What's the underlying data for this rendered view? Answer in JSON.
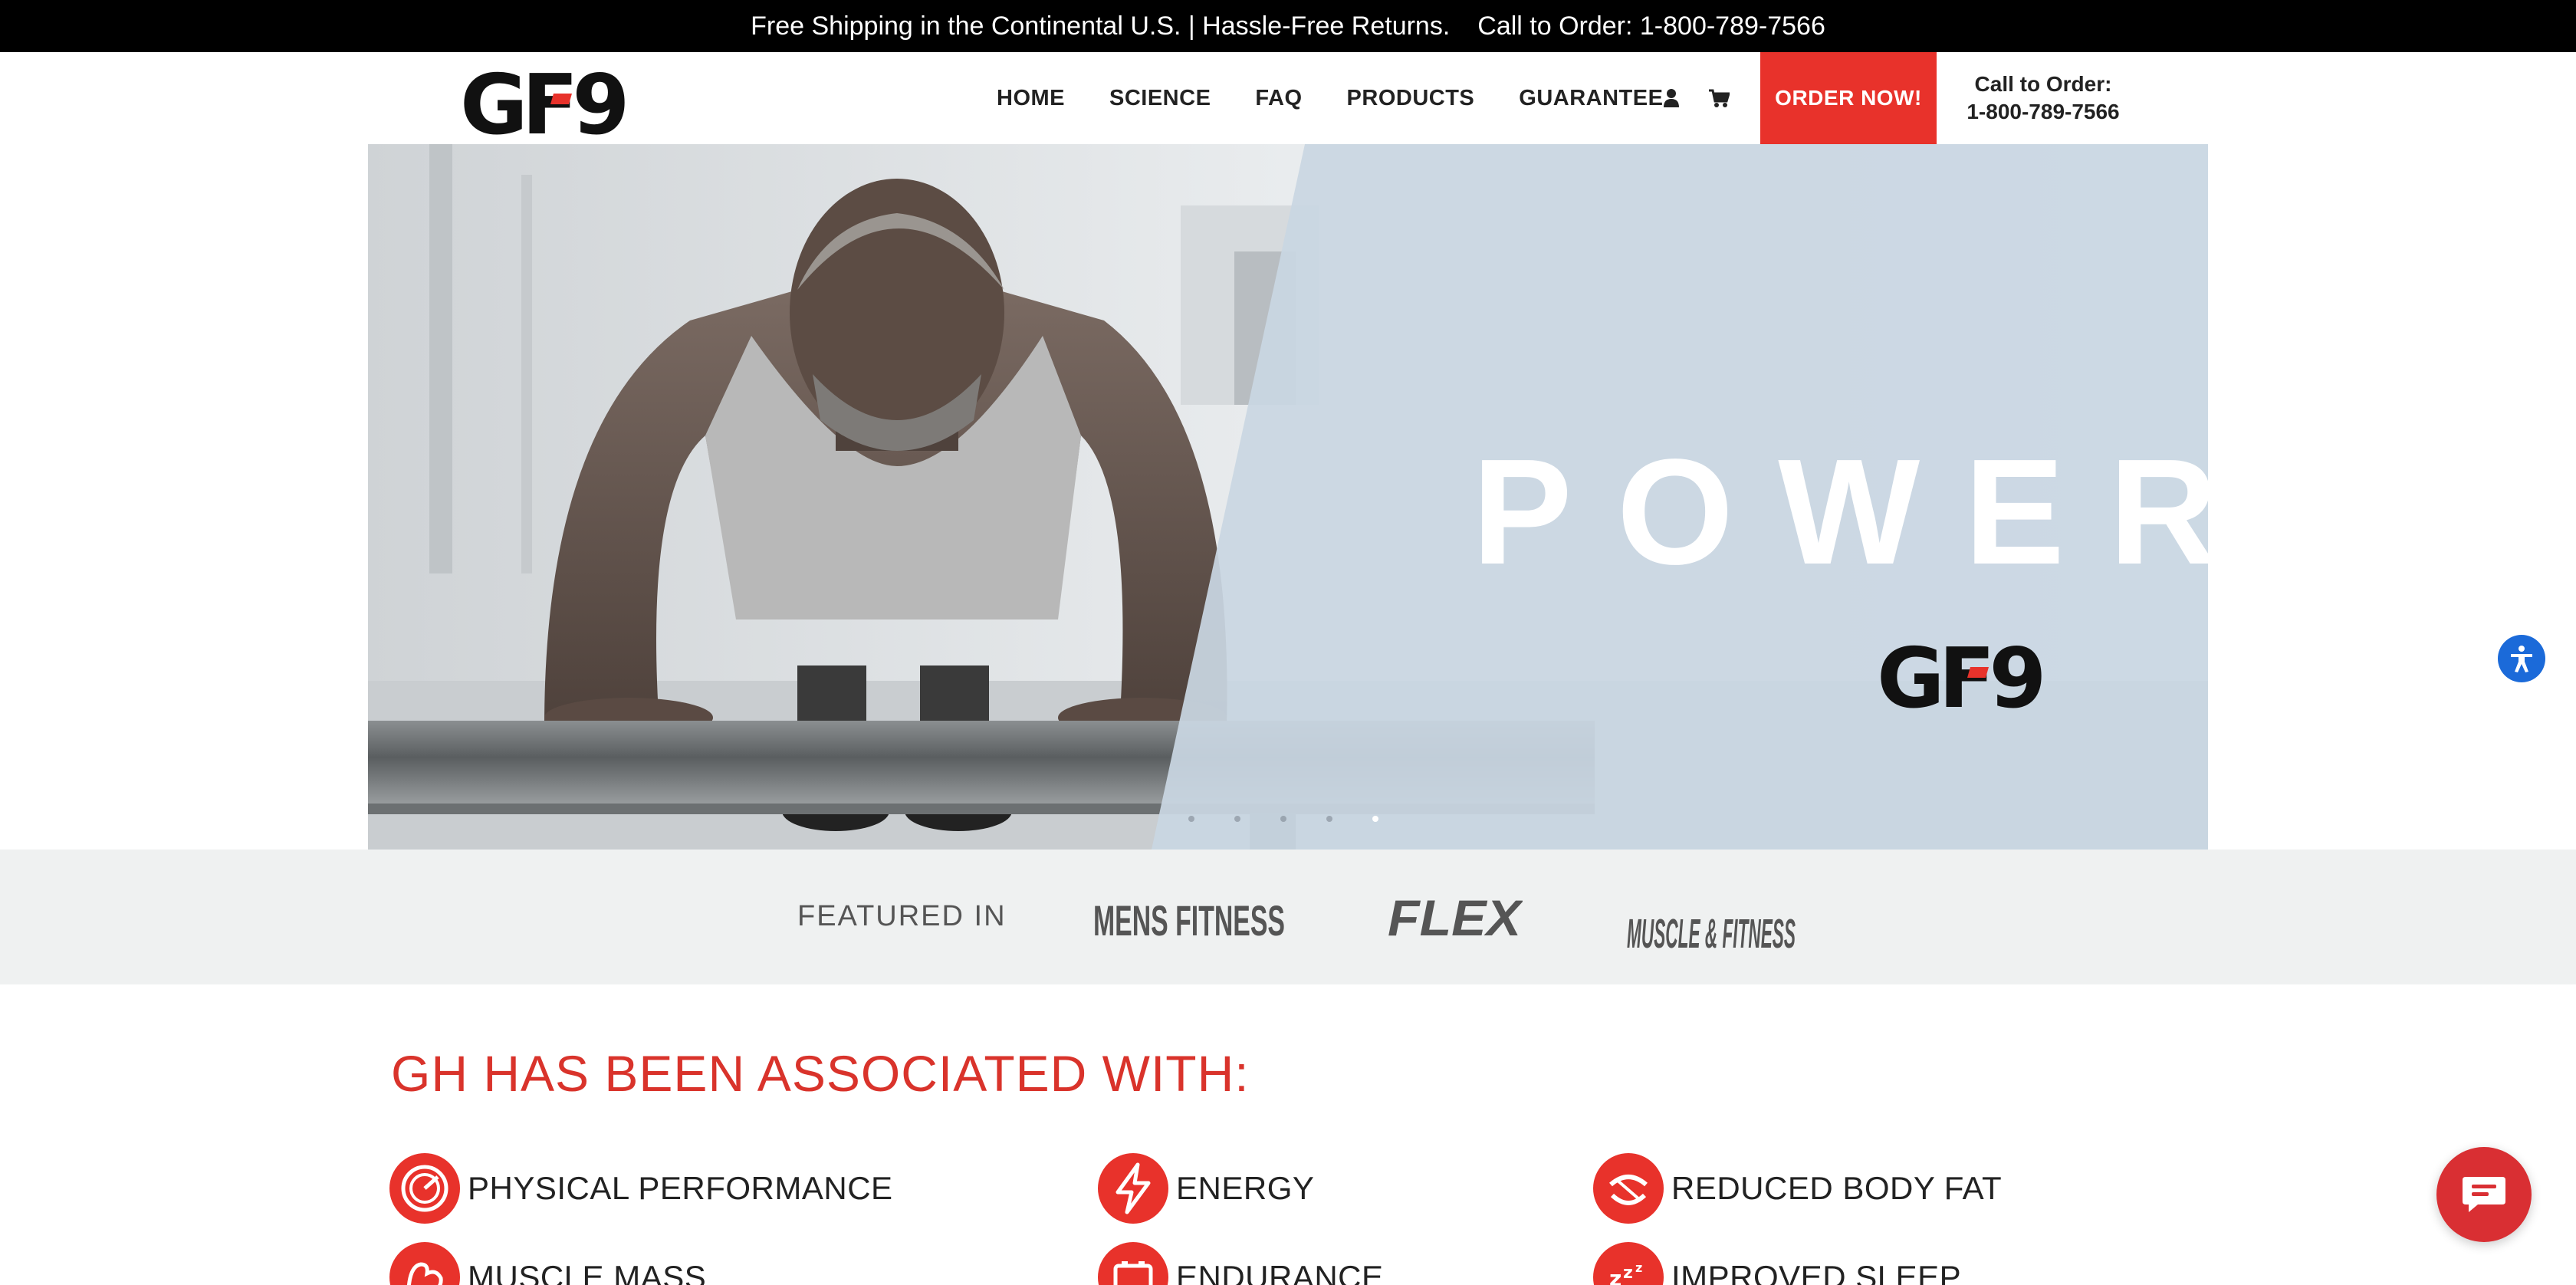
{
  "topbar": {
    "shipping": "Free Shipping in the Continental U.S. | Hassle-Free Returns.",
    "call": "Call to Order: 1-800-789-7566"
  },
  "header": {
    "logo_text": "GF9",
    "nav": [
      "HOME",
      "SCIENCE",
      "FAQ",
      "PRODUCTS",
      "GUARANTEE"
    ],
    "order_button": "ORDER NOW!",
    "call_label": "Call to Order:",
    "call_number": "1-800-789-7566",
    "icons": [
      "user-icon",
      "cart-icon"
    ]
  },
  "hero": {
    "headline": "POWER",
    "logo_text": "GF9",
    "slide_count": 5,
    "active_slide": 5
  },
  "featured": {
    "label": "FEATURED IN",
    "logos": [
      "MENS FITNESS",
      "FLEX",
      "MUSCLE & FITNESS"
    ]
  },
  "benefits": {
    "title": "GH HAS BEEN ASSOCIATED WITH:",
    "items": [
      {
        "label": "PHYSICAL PERFORMANCE",
        "icon": "speedometer-icon"
      },
      {
        "label": "ENERGY",
        "icon": "lightning-icon"
      },
      {
        "label": "REDUCED BODY FAT",
        "icon": "tape-measure-icon"
      },
      {
        "label": "MUSCLE MASS",
        "icon": "muscle-icon"
      },
      {
        "label": "ENDURANCE",
        "icon": "battery-icon"
      },
      {
        "label": "IMPROVED SLEEP",
        "icon": "sleep-icon"
      }
    ]
  },
  "colors": {
    "brand_red": "#e8322b",
    "hero_panel": "#cbd8e3",
    "featured_bg": "#eff1f1",
    "accessibility_blue": "#1b6ad9"
  },
  "widgets": [
    "accessibility-icon",
    "chat-icon"
  ]
}
